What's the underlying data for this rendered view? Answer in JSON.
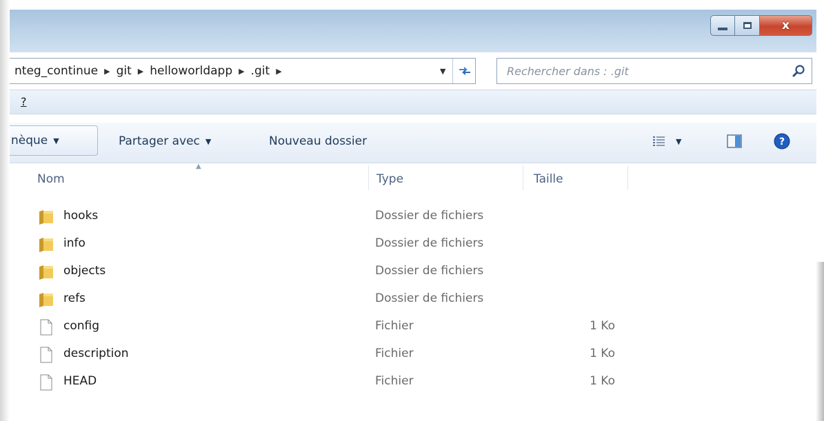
{
  "window": {
    "caption": {
      "close_glyph": "x"
    }
  },
  "address": {
    "crumbs": [
      "nteg_continue",
      "git",
      "helloworldapp",
      ".git"
    ]
  },
  "search": {
    "placeholder": "Rechercher dans : .git"
  },
  "menubar": {
    "item": "?"
  },
  "toolbar": {
    "library_label": "nèque",
    "share_label": "Partager avec",
    "new_folder_label": "Nouveau dossier"
  },
  "columns": {
    "name": "Nom",
    "type": "Type",
    "size": "Taille"
  },
  "files": [
    {
      "name": "hooks",
      "type": "Dossier de fichiers",
      "size": "",
      "icon": "folder-icon"
    },
    {
      "name": "info",
      "type": "Dossier de fichiers",
      "size": "",
      "icon": "folder-icon"
    },
    {
      "name": "objects",
      "type": "Dossier de fichiers",
      "size": "",
      "icon": "folder-icon"
    },
    {
      "name": "refs",
      "type": "Dossier de fichiers",
      "size": "",
      "icon": "folder-icon"
    },
    {
      "name": "config",
      "type": "Fichier",
      "size": "1 Ko",
      "icon": "file-icon"
    },
    {
      "name": "description",
      "type": "Fichier",
      "size": "1 Ko",
      "icon": "file-icon"
    },
    {
      "name": "HEAD",
      "type": "Fichier",
      "size": "1 Ko",
      "icon": "file-icon"
    }
  ],
  "colors": {
    "titlebar": "#b8cfe6",
    "close_button": "#c8452e",
    "link_text": "#1e395b",
    "secondary_text": "#6a6a6a"
  }
}
